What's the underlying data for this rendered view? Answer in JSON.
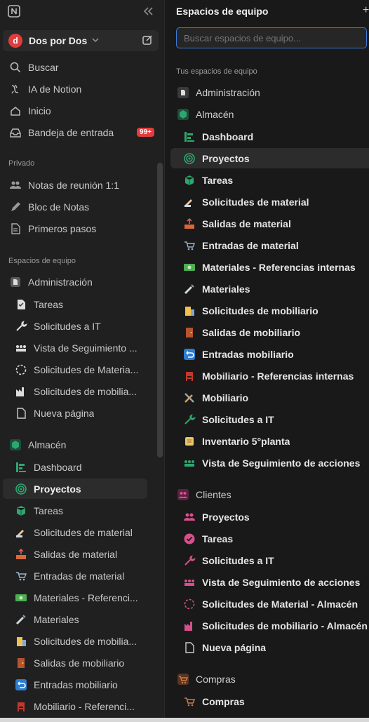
{
  "workspace": {
    "name": "Dos por Dos"
  },
  "search_label": "Buscar",
  "top_nav": [
    {
      "label": "IA de Notion"
    },
    {
      "label": "Inicio"
    },
    {
      "label": "Bandeja de entrada",
      "badge": "99+"
    }
  ],
  "sections": {
    "private": "Privado",
    "team": "Espacios de equipo"
  },
  "private_items": [
    {
      "label": "Notas de reunión 1:1"
    },
    {
      "label": "Bloc de Notas"
    },
    {
      "label": "Primeros pasos"
    }
  ],
  "sidebar_admin": {
    "title": "Administración",
    "items": [
      {
        "label": "Tareas"
      },
      {
        "label": "Solicitudes a IT"
      },
      {
        "label": "Vista de Seguimiento ..."
      },
      {
        "label": "Solicitudes de Materia..."
      },
      {
        "label": "Solicitudes de mobilia..."
      },
      {
        "label": "Nueva página"
      }
    ]
  },
  "sidebar_almacen": {
    "title": "Almacén",
    "items": [
      {
        "label": "Dashboard"
      },
      {
        "label": "Proyectos"
      },
      {
        "label": "Tareas"
      },
      {
        "label": "Solicitudes de material"
      },
      {
        "label": "Salidas de material"
      },
      {
        "label": "Entradas de material"
      },
      {
        "label": "Materiales - Referenci..."
      },
      {
        "label": "Materiales"
      },
      {
        "label": "Solicitudes de mobilia..."
      },
      {
        "label": "Salidas de mobiliario"
      },
      {
        "label": "Entradas mobiliario"
      },
      {
        "label": "Mobiliario - Referenci..."
      }
    ]
  },
  "panel": {
    "title": "Espacios de equipo",
    "search_placeholder": "Buscar espacios de equipo...",
    "subtitle": "Tus espacios de equipo",
    "admin_title": "Administración",
    "almacen_title": "Almacén",
    "almacen_items": [
      {
        "label": "Dashboard"
      },
      {
        "label": "Proyectos"
      },
      {
        "label": "Tareas"
      },
      {
        "label": "Solicitudes de material"
      },
      {
        "label": "Salidas de material"
      },
      {
        "label": "Entradas de material"
      },
      {
        "label": "Materiales - Referencias internas"
      },
      {
        "label": "Materiales"
      },
      {
        "label": "Solicitudes de mobiliario"
      },
      {
        "label": "Salidas de mobiliario"
      },
      {
        "label": "Entradas mobiliario"
      },
      {
        "label": "Mobiliario - Referencias internas"
      },
      {
        "label": "Mobiliario"
      },
      {
        "label": "Solicitudes a IT"
      },
      {
        "label": "Inventario 5°planta"
      },
      {
        "label": "Vista de Seguimiento de acciones"
      }
    ],
    "clientes_title": "Clientes",
    "clientes_items": [
      {
        "label": "Proyectos"
      },
      {
        "label": "Tareas"
      },
      {
        "label": "Solicitudes a IT"
      },
      {
        "label": "Vista de Seguimiento de acciones"
      },
      {
        "label": "Solicitudes de Material - Almacén"
      },
      {
        "label": "Solicitudes de mobiliario - Almacén"
      },
      {
        "label": "Nueva página"
      }
    ],
    "compras_title": "Compras",
    "compras_items": [
      {
        "label": "Compras"
      }
    ]
  },
  "colors": {
    "accent_green": "#2ea66f",
    "accent_pink": "#d94f8c",
    "accent_brown": "#a0522d",
    "badge_red": "#e03e3e"
  }
}
